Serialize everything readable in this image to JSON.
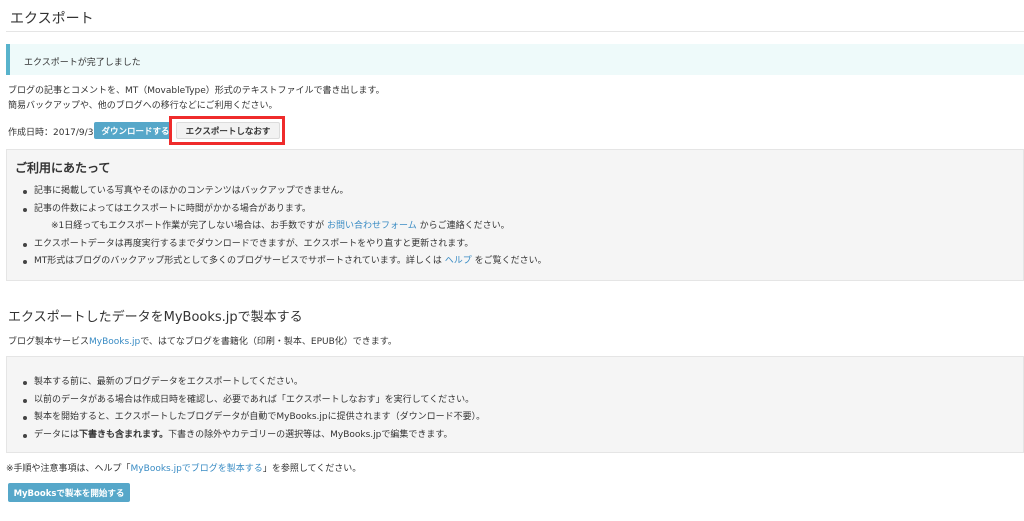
{
  "page": {
    "title": "エクスポート"
  },
  "notice": {
    "text": "エクスポートが完了しました"
  },
  "description": {
    "line1": "ブログの記事とコメントを、MT（MovableType）形式のテキストファイルで書き出します。",
    "line2": "簡易バックアップや、他のブログへの移行などにご利用ください。"
  },
  "export": {
    "created_label": "作成日時：2017/9/30",
    "download_label": "ダウンロードする",
    "redo_label": "エクスポートしなおす"
  },
  "notes": {
    "heading": "ご利用にあたって",
    "items": [
      "記事に掲載している写真やそのほかのコンテンツはバックアップできません。",
      "記事の件数によってはエクスポートに時間がかかる場合があります。"
    ],
    "sub_prefix": "※1日経ってもエクスポート作業が完了しない場合は、お手数ですが",
    "sub_link": "お問い合わせフォーム",
    "sub_suffix": "からご連絡ください。",
    "item3": "エクスポートデータは再度実行するまでダウンロードできますが、エクスポートをやり直すと更新されます。",
    "item4_prefix": "MT形式はブログのバックアップ形式として多くのブログサービスでサポートされています。詳しくは",
    "item4_link": "ヘルプ",
    "item4_suffix": "をご覧ください。"
  },
  "mybooks": {
    "heading": "エクスポートしたデータをMyBooks.jpで製本する",
    "desc_prefix": "ブログ製本サービス",
    "desc_link": "MyBooks.jp",
    "desc_suffix": "で、はてなブログを書籍化（印刷・製本、EPUB化）できます。",
    "items": [
      "製本する前に、最新のブログデータをエクスポートしてください。",
      "以前のデータがある場合は作成日時を確認し、必要であれば「エクスポートしなおす」を実行してください。",
      "製本を開始すると、エクスポートしたブログデータが自動でMyBooks.jpに提供されます（ダウンロード不要）。"
    ],
    "item4_prefix": "データには",
    "item4_bold": "下書きも含まれます。",
    "item4_suffix": "下書きの除外やカテゴリーの選択等は、MyBooks.jpで編集できます。",
    "footnote_prefix": "※手順や注意事項は、ヘルプ「",
    "footnote_link": "MyBooks.jpでブログを製本する",
    "footnote_suffix": "」を参照してください。",
    "start_label": "MyBooksで製本を開始する"
  },
  "colors": {
    "accent": "#56a7c9",
    "link": "#3a8cc4",
    "highlight": "#ef2b2b"
  }
}
